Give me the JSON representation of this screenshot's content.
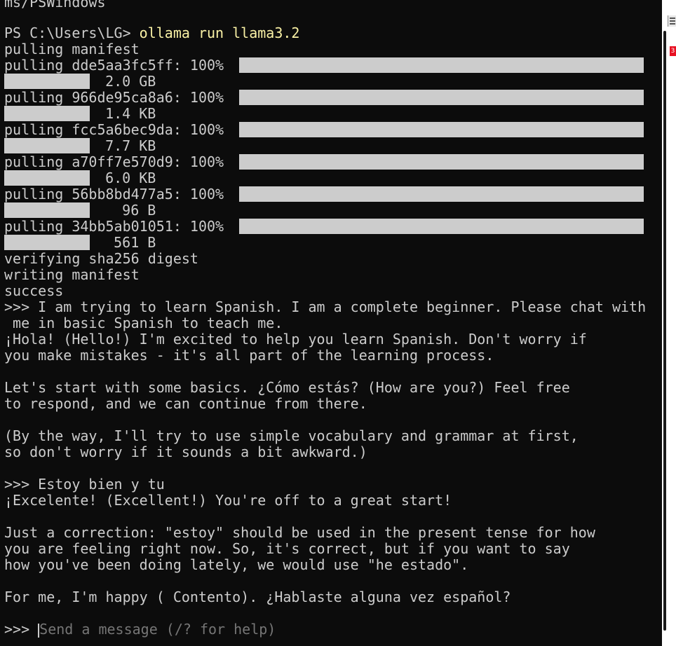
{
  "terminal": {
    "top_fragment": "ms/PSWindows",
    "prompt": "PS C:\\Users\\LG> ",
    "command": "ollama run llama3.2",
    "pulling_manifest": "pulling manifest",
    "layers": [
      {
        "line": "pulling dde5aa3fc5ff: 100% ",
        "size": "  2.0 GB",
        "progress_percent": 100
      },
      {
        "line": "pulling 966de95ca8a6: 100% ",
        "size": "  1.4 KB",
        "progress_percent": 100
      },
      {
        "line": "pulling fcc5a6bec9da: 100% ",
        "size": "  7.7 KB",
        "progress_percent": 100
      },
      {
        "line": "pulling a70ff7e570d9: 100% ",
        "size": "  6.0 KB",
        "progress_percent": 100
      },
      {
        "line": "pulling 56bb8bd477a5: 100% ",
        "size": "    96 B",
        "progress_percent": 100
      },
      {
        "line": "pulling 34bb5ab01051: 100% ",
        "size": "   561 B",
        "progress_percent": 100
      }
    ],
    "verifying": "verifying sha256 digest",
    "writing_manifest": "writing manifest",
    "success": "success",
    "user_message_1_line_1": ">>> I am trying to learn Spanish. I am a complete beginner. Please chat with",
    "user_message_1_line_2": " me in basic Spanish to teach me.",
    "reply_1": [
      "¡Hola! (Hello!) I'm excited to help you learn Spanish. Don't worry if",
      "you make mistakes - it's all part of the learning process.",
      "",
      "Let's start with some basics. ¿Cómo estás? (How are you?) Feel free",
      "to respond, and we can continue from there.",
      "",
      "(By the way, I'll try to use simple vocabulary and grammar at first,",
      "so don't worry if it sounds a bit awkward.)",
      ""
    ],
    "user_message_2": ">>> Estoy bien y tu",
    "reply_2": [
      "¡Excelente! (Excellent!) You're off to a great start!",
      "",
      "Just a correction: \"estoy\" should be used in the present tense for how",
      "you are feeling right now. So, it's correct, but if you want to say",
      "how you've been doing lately, we would use \"he estado\".",
      "",
      "For me, I'm happy ( Contento). ¿Hablaste alguna vez español?",
      ""
    ],
    "input_prompt": ">>> ",
    "input_placeholder": "Send a message (/? for help)"
  },
  "notification_badge": "3",
  "colors": {
    "background": "#0c0c0c",
    "text": "#cccccc",
    "command": "#f9f1a5",
    "placeholder": "#767676",
    "progress_bar": "#cccccc"
  }
}
